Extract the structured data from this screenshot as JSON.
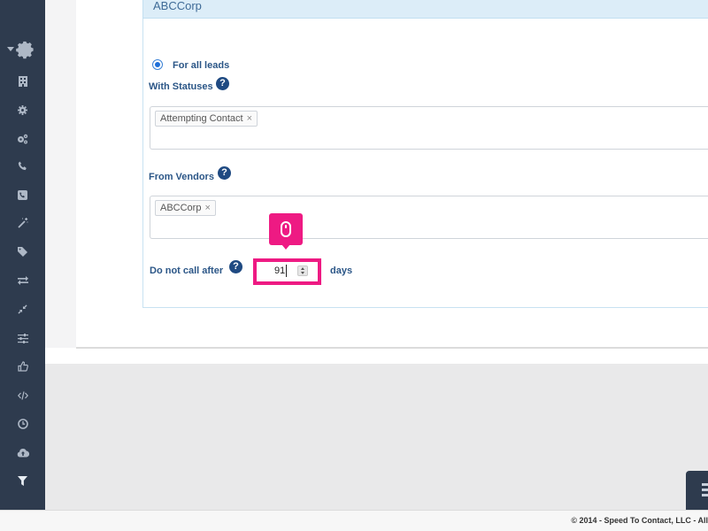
{
  "sidebar": {
    "items": [
      {
        "icon": "gear-large-icon"
      },
      {
        "icon": "building-icon"
      },
      {
        "icon": "gear-icon"
      },
      {
        "icon": "gears-icon"
      },
      {
        "icon": "phone-icon"
      },
      {
        "icon": "phone-square-icon"
      },
      {
        "icon": "magic-wand-icon"
      },
      {
        "icon": "tag-icon"
      },
      {
        "icon": "exchange-icon"
      },
      {
        "icon": "compress-icon"
      },
      {
        "icon": "sliders-icon"
      },
      {
        "icon": "thumbs-up-icon"
      },
      {
        "icon": "code-icon"
      },
      {
        "icon": "clock-icon"
      },
      {
        "icon": "cloud-upload-icon"
      },
      {
        "icon": "filter-icon"
      }
    ]
  },
  "panel": {
    "title": "ABCCorp"
  },
  "form": {
    "radio_label": "For all leads",
    "statuses_label": "With Statuses",
    "statuses_tags": [
      "Attempting Contact"
    ],
    "vendors_label": "From Vendors",
    "vendors_tags": [
      "ABCCorp"
    ],
    "do_not_call_label": "Do not call after",
    "do_not_call_value": "91",
    "days_label": "days",
    "help_glyph": "?",
    "tag_remove_glyph": "×"
  },
  "footer": {
    "text": "© 2014 - Speed To Contact, LLC - All"
  },
  "colors": {
    "sidebar": "#2e3b4e",
    "accent": "#ee1a83",
    "label": "#2b5687"
  }
}
